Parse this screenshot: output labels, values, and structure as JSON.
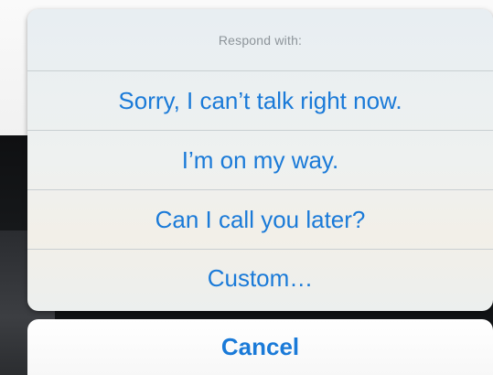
{
  "action_sheet": {
    "header": "Respond with:",
    "options": [
      "Sorry, I can’t talk right now.",
      "I’m on my way.",
      "Can I call you later?",
      "Custom…"
    ],
    "cancel_label": "Cancel"
  },
  "colors": {
    "accent": "#1a7ad8",
    "header_text": "#8d949a"
  }
}
